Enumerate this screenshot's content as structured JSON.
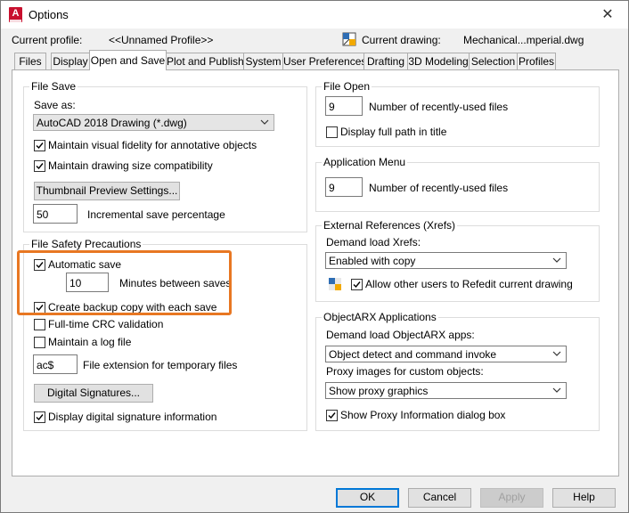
{
  "window": {
    "title": "Options",
    "close_glyph": "✕",
    "app_icon_letter": "A"
  },
  "profile": {
    "current_profile_label": "Current profile:",
    "current_profile_value": "<<Unnamed Profile>>",
    "current_drawing_label": "Current drawing:",
    "current_drawing_value": "Mechanical...mperial.dwg"
  },
  "tabs": [
    {
      "label": "Files"
    },
    {
      "label": "Display"
    },
    {
      "label": "Open and Save"
    },
    {
      "label": "Plot and Publish"
    },
    {
      "label": "System"
    },
    {
      "label": "User Preferences"
    },
    {
      "label": "Drafting"
    },
    {
      "label": "3D Modeling"
    },
    {
      "label": "Selection"
    },
    {
      "label": "Profiles"
    }
  ],
  "active_tab": "Open and Save",
  "file_save": {
    "title": "File Save",
    "save_as_label": "Save as:",
    "save_as_value": "AutoCAD 2018 Drawing (*.dwg)",
    "maintain_fidelity_label": "Maintain visual fidelity for annotative objects",
    "maintain_fidelity_checked": true,
    "maintain_size_label": "Maintain drawing size compatibility",
    "maintain_size_checked": true,
    "thumbnail_button": "Thumbnail Preview Settings...",
    "incremental_value": "50",
    "incremental_label": "Incremental save percentage"
  },
  "file_safety": {
    "title": "File Safety Precautions",
    "automatic_save_label": "Automatic save",
    "automatic_save_checked": true,
    "minutes_value": "10",
    "minutes_label": "Minutes between saves",
    "backup_label": "Create backup copy with each save",
    "backup_checked": true,
    "crc_label": "Full-time CRC validation",
    "crc_checked": false,
    "log_label": "Maintain a log file",
    "log_checked": false,
    "temp_ext_value": "ac$",
    "temp_ext_label": "File extension for temporary files",
    "digital_signatures_button": "Digital Signatures...",
    "display_signature_label": "Display digital signature information",
    "display_signature_checked": true
  },
  "file_open": {
    "title": "File Open",
    "recent_value": "9",
    "recent_label": "Number of recently-used files",
    "full_path_label": "Display full path in title",
    "full_path_checked": false
  },
  "app_menu": {
    "title": "Application Menu",
    "recent_value": "9",
    "recent_label": "Number of recently-used files"
  },
  "xrefs": {
    "title": "External References (Xrefs)",
    "demand_label": "Demand load Xrefs:",
    "demand_value": "Enabled with copy",
    "refedit_label": "Allow other users to Refedit current drawing",
    "refedit_checked": true
  },
  "objectarx": {
    "title": "ObjectARX Applications",
    "demand_label": "Demand load ObjectARX apps:",
    "demand_value": "Object detect and command invoke",
    "proxy_label": "Proxy images for custom objects:",
    "proxy_value": "Show proxy graphics",
    "show_proxy_label": "Show Proxy Information dialog box",
    "show_proxy_checked": true
  },
  "buttons": {
    "ok": "OK",
    "cancel": "Cancel",
    "apply": "Apply",
    "help": "Help"
  },
  "colors": {
    "highlight": "#e87722",
    "app_red": "#c8102e",
    "primary_border": "#0078d7"
  }
}
